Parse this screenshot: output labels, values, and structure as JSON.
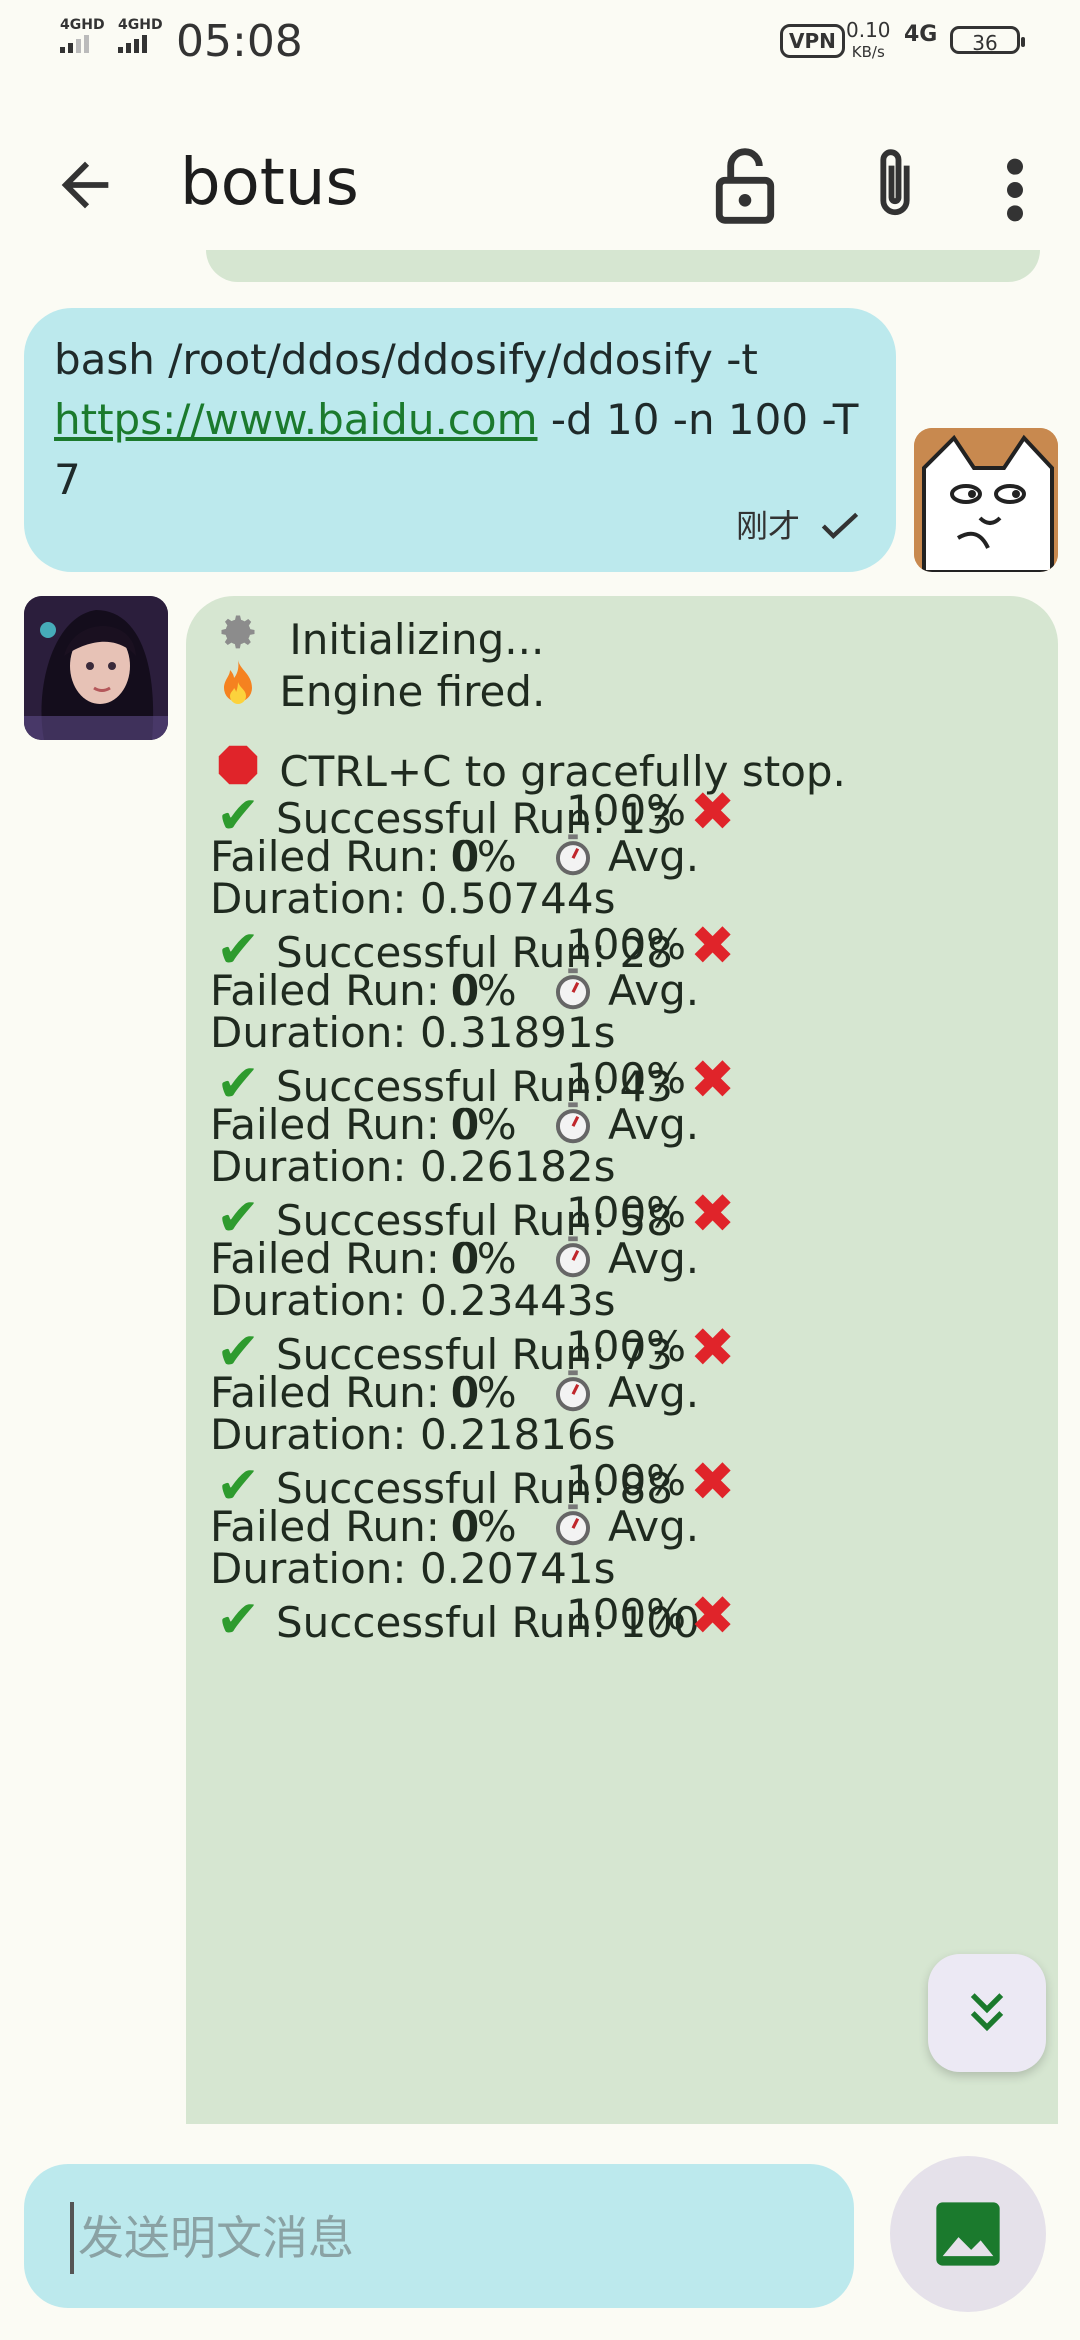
{
  "status": {
    "sim1": "4GHD",
    "sim2": "4GHD",
    "time": "05:08",
    "vpn": "VPN",
    "speed_value": "0.10",
    "speed_unit": "KB/s",
    "network": "4G",
    "battery": "36"
  },
  "header": {
    "title": "botus"
  },
  "outgoing": {
    "text_before": "bash /root/ddos/ddosify/ddosify -t ",
    "link": "https://www.baidu.com",
    "text_after": " -d 10 -n 100 -T 7",
    "time": "刚才",
    "status_icon": "double-check-icon"
  },
  "incoming": {
    "init": "Initializing...",
    "fired": "Engine fired.",
    "stop": "CTRL+C to gracefully stop.",
    "success_label": "Successful Run:",
    "failed_label": "Failed Run:",
    "avg_label": "Avg.",
    "duration_label": "Duration:",
    "runs": [
      {
        "success": "13",
        "success_pct": "100%",
        "failed": "0",
        "failed_pct": "0%",
        "duration": "0.50744s"
      },
      {
        "success": "28",
        "success_pct": "100%",
        "failed": "0",
        "failed_pct": "0%",
        "duration": "0.31891s"
      },
      {
        "success": "43",
        "success_pct": "100%",
        "failed": "0",
        "failed_pct": "0%",
        "duration": "0.26182s"
      },
      {
        "success": "58",
        "success_pct": "100%",
        "failed": "0",
        "failed_pct": "0%",
        "duration": "0.23443s"
      },
      {
        "success": "73",
        "success_pct": "100%",
        "failed": "0",
        "failed_pct": "0%",
        "duration": "0.21816s"
      },
      {
        "success": "88",
        "success_pct": "100%",
        "failed": "0",
        "failed_pct": "0%",
        "duration": "0.20741s"
      },
      {
        "success": "100",
        "success_pct": "100%"
      }
    ]
  },
  "composer": {
    "placeholder": "发送明文消息"
  },
  "colors": {
    "outgoing_bubble": "#bce9ed",
    "incoming_bubble": "#d6e6d1",
    "link": "#1b7a2d",
    "accent_green": "#1b7a2d"
  }
}
